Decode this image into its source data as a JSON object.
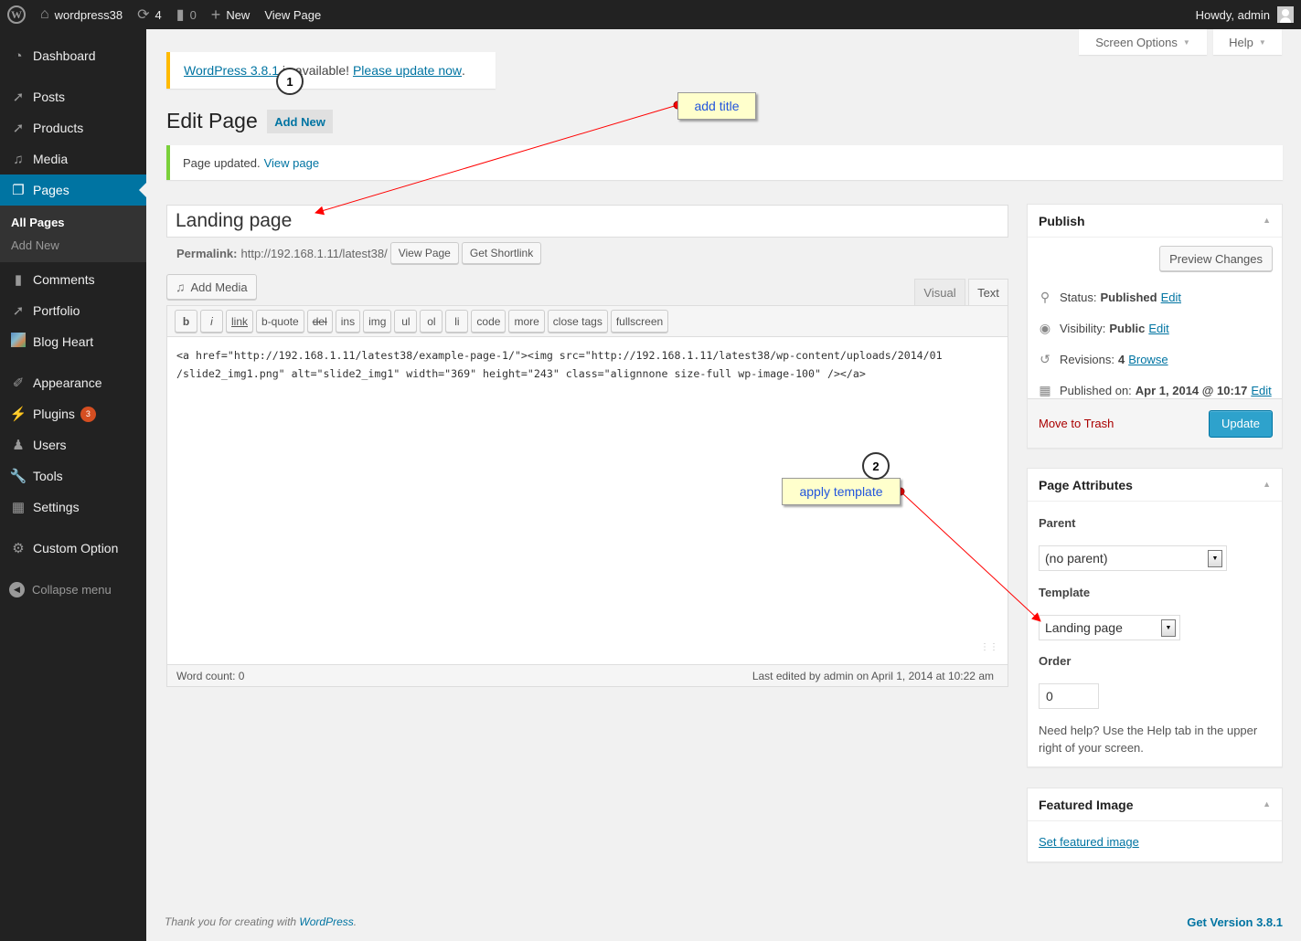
{
  "adminbar": {
    "site_name": "wordpress38",
    "updates_count": "4",
    "comments_count": "0",
    "new_label": "New",
    "view_page_label": "View Page",
    "howdy": "Howdy, admin"
  },
  "sidebar": {
    "items": [
      {
        "label": "Dashboard",
        "icon": "dashboard-icon"
      },
      {
        "label": "Posts",
        "icon": "pin-icon"
      },
      {
        "label": "Products",
        "icon": "pin-icon"
      },
      {
        "label": "Media",
        "icon": "media-icon"
      },
      {
        "label": "Pages",
        "icon": "pages-icon",
        "active": true
      },
      {
        "label": "Comments",
        "icon": "comment-icon"
      },
      {
        "label": "Portfolio",
        "icon": "pin-icon"
      },
      {
        "label": "Blog Heart",
        "icon": "blog-heart-icon"
      },
      {
        "label": "Appearance",
        "icon": "brush-icon"
      },
      {
        "label": "Plugins",
        "icon": "plugin-icon",
        "badge": "3"
      },
      {
        "label": "Users",
        "icon": "user-icon"
      },
      {
        "label": "Tools",
        "icon": "wrench-icon"
      },
      {
        "label": "Settings",
        "icon": "settings-icon"
      },
      {
        "label": "Custom Option",
        "icon": "gear-icon"
      }
    ],
    "pages_submenu": [
      "All Pages",
      "Add New"
    ],
    "collapse_label": "Collapse menu"
  },
  "screen_meta": {
    "screen_options": "Screen Options",
    "help": "Help"
  },
  "update_nag": {
    "version_link": "WordPress 3.8.1",
    "middle_text": " is available! ",
    "update_link": "Please update now",
    "end": "."
  },
  "header": {
    "title": "Edit Page",
    "add_new": "Add New"
  },
  "updated_notice": {
    "text": "Page updated.",
    "link": "View page"
  },
  "post": {
    "title_value": "Landing page",
    "permalink_label": "Permalink:",
    "permalink_url": "http://192.168.1.11/latest38/",
    "view_page_btn": "View Page",
    "get_shortlink_btn": "Get Shortlink"
  },
  "editor": {
    "add_media": "Add Media",
    "tabs": {
      "visual": "Visual",
      "text": "Text"
    },
    "quicktags": [
      "b",
      "i",
      "link",
      "b-quote",
      "del",
      "ins",
      "img",
      "ul",
      "ol",
      "li",
      "code",
      "more",
      "close tags",
      "fullscreen"
    ],
    "content": "<a href=\"http://192.168.1.11/latest38/example-page-1/\"><img src=\"http://192.168.1.11/latest38/wp-content/uploads/2014/01\n/slide2_img1.png\" alt=\"slide2_img1\" width=\"369\" height=\"243\" class=\"alignnone size-full wp-image-100\" /></a>",
    "word_count": "Word count: 0",
    "last_edited": "Last edited by admin on April 1, 2014 at 10:22 am"
  },
  "publish": {
    "title": "Publish",
    "preview_btn": "Preview Changes",
    "status_label": "Status:",
    "status_value": "Published",
    "visibility_label": "Visibility:",
    "visibility_value": "Public",
    "revisions_label": "Revisions:",
    "revisions_value": "4",
    "browse_link": "Browse",
    "published_label": "Published on:",
    "published_value": "Apr 1, 2014 @ 10:17",
    "edit_link": "Edit",
    "trash_link": "Move to Trash",
    "update_btn": "Update"
  },
  "page_attributes": {
    "title": "Page Attributes",
    "parent_label": "Parent",
    "parent_value": "(no parent)",
    "template_label": "Template",
    "template_value": "Landing page",
    "order_label": "Order",
    "order_value": "0",
    "help_text": "Need help? Use the Help tab in the upper right of your screen."
  },
  "featured_image": {
    "title": "Featured Image",
    "link": "Set featured image"
  },
  "footer": {
    "thanks_prefix": "Thank you for creating with ",
    "thanks_link": "WordPress",
    "thanks_suffix": ".",
    "version": "Get Version 3.8.1"
  },
  "annotations": {
    "step1_number": "1",
    "step1_label": "add title",
    "step2_number": "2",
    "step2_label": "apply template",
    "arrow_color": "#ff0000"
  }
}
